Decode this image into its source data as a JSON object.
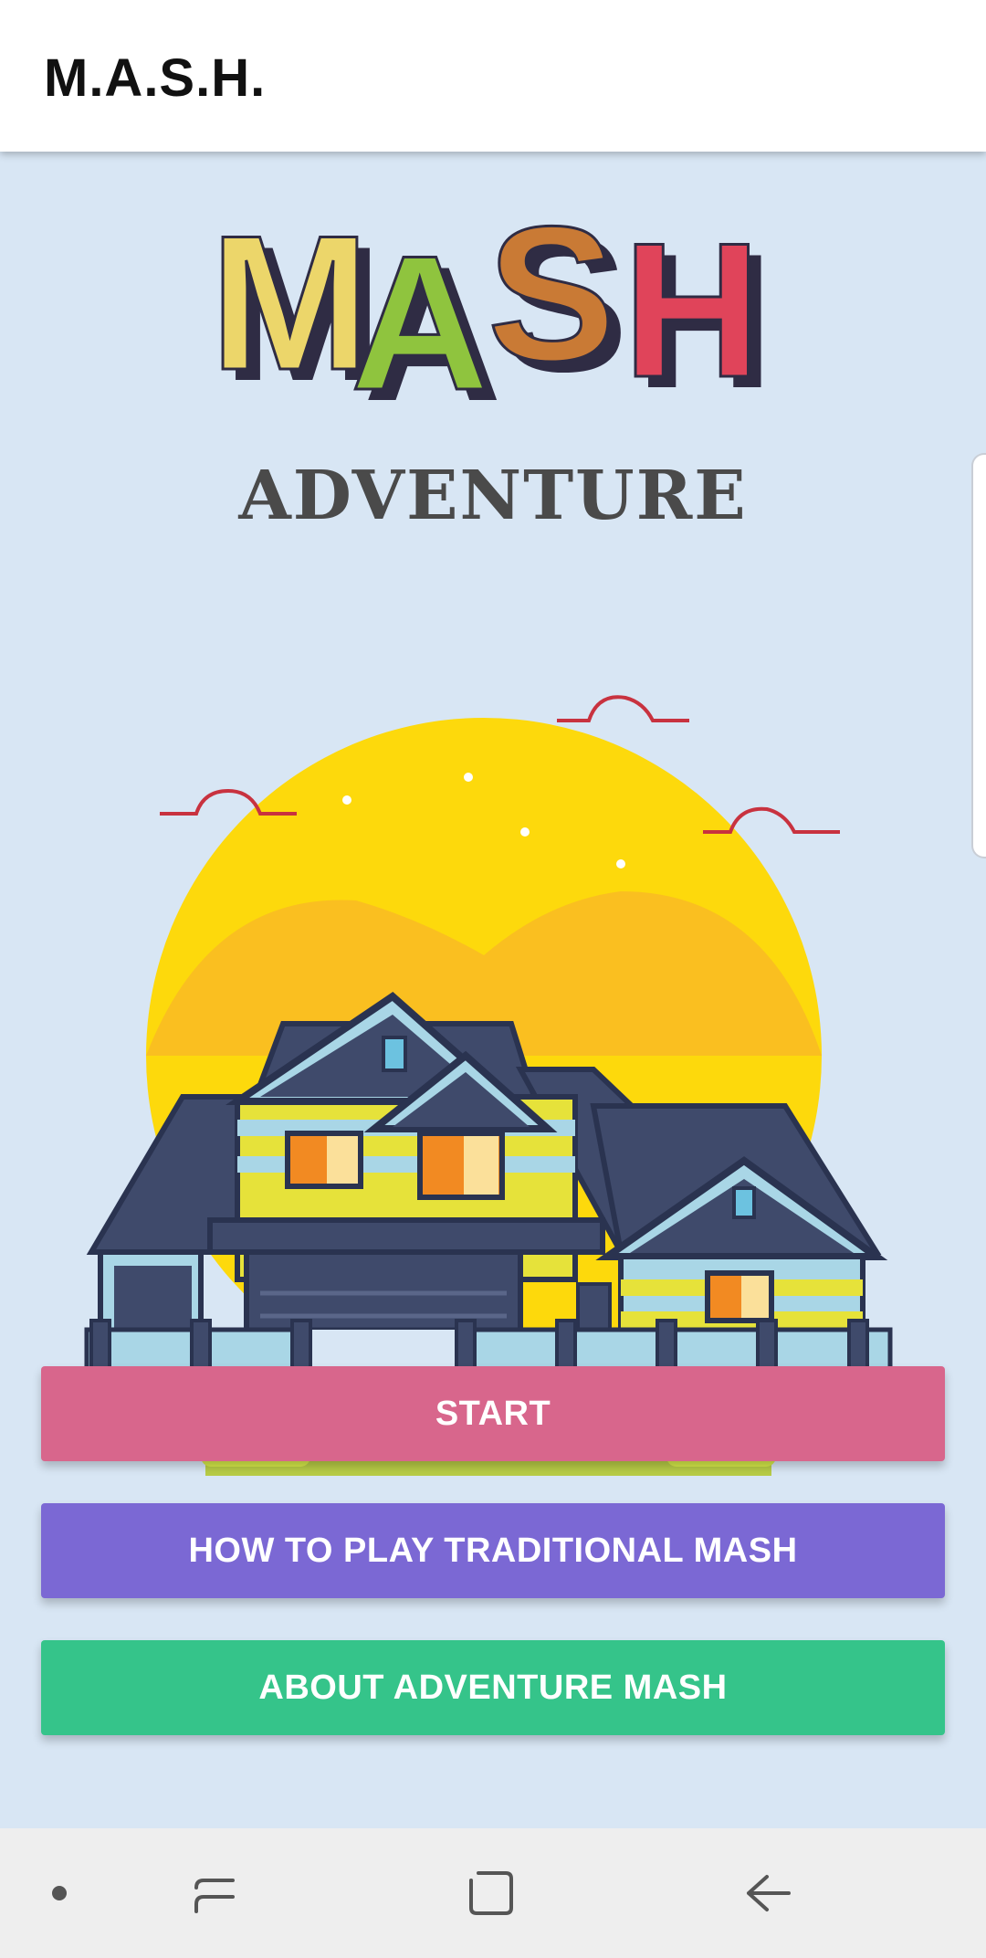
{
  "app_bar": {
    "title": "M.A.S.H."
  },
  "logo": {
    "letters": [
      "M",
      "A",
      "S",
      "H"
    ],
    "letter_colors": [
      "#ecd66a",
      "#8fc43e",
      "#c97a35",
      "#e0445a"
    ],
    "subtitle": "ADVENTURE"
  },
  "illustration": {
    "subject": "house-with-sunset"
  },
  "buttons": {
    "start": {
      "label": "START",
      "color": "#d8668c"
    },
    "how_to_play": {
      "label": "HOW TO PLAY TRADITIONAL MASH",
      "color": "#7b68d4"
    },
    "about": {
      "label": "ABOUT ADVENTURE MASH",
      "color": "#35c48a"
    }
  },
  "nav_bar": {
    "items": [
      "dot-icon",
      "recent-apps-icon",
      "home-icon",
      "back-icon"
    ]
  },
  "colors": {
    "background": "#d8e6f4",
    "sun": "#fdd90c",
    "house_roof": "#3f4a6b"
  }
}
